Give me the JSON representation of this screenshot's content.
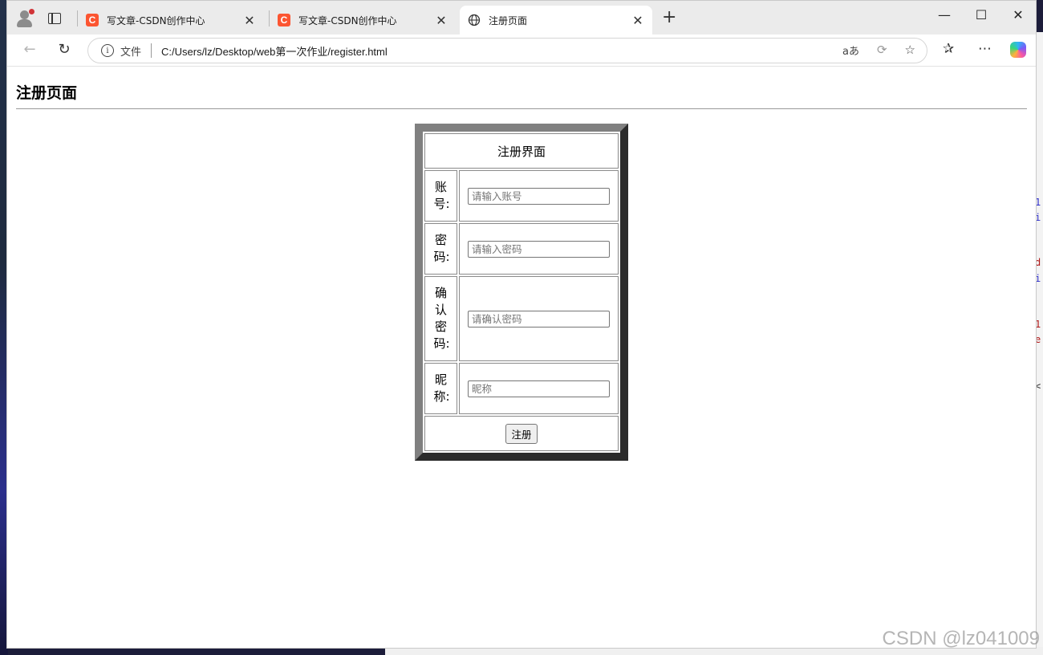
{
  "browser": {
    "tabs": [
      {
        "title": "写文章-CSDN创作中心",
        "icon": "csdn-icon",
        "active": false
      },
      {
        "title": "写文章-CSDN创作中心",
        "icon": "csdn-icon",
        "active": false
      },
      {
        "title": "注册页面",
        "icon": "globe-icon",
        "active": true
      }
    ],
    "new_tab": "+",
    "scheme_label": "文件",
    "url": "C:/Users/lz/Desktop/web第一次作业/register.html",
    "read_aloud": "aあ",
    "icons": [
      "back-icon",
      "refresh-icon",
      "info-icon",
      "read-aloud-icon",
      "refresh-page-icon",
      "favorite-icon",
      "favorites-icon",
      "more-icon",
      "copilot-icon"
    ]
  },
  "page": {
    "heading": "注册页面",
    "form": {
      "caption": "注册界面",
      "rows": [
        {
          "label": "账号:",
          "placeholder": "请输入账号"
        },
        {
          "label": "密码:",
          "placeholder": "请输入密码"
        },
        {
          "label": "确认密码:",
          "placeholder": "请确认密码"
        },
        {
          "label": "昵称:",
          "placeholder": "昵称"
        }
      ],
      "submit_label": "注册"
    }
  },
  "watermark": "CSDN @lz041009",
  "colors": {
    "csdn": "#fc5531",
    "table_border_light": "#808080",
    "table_border_dark": "#2b2b2b"
  }
}
